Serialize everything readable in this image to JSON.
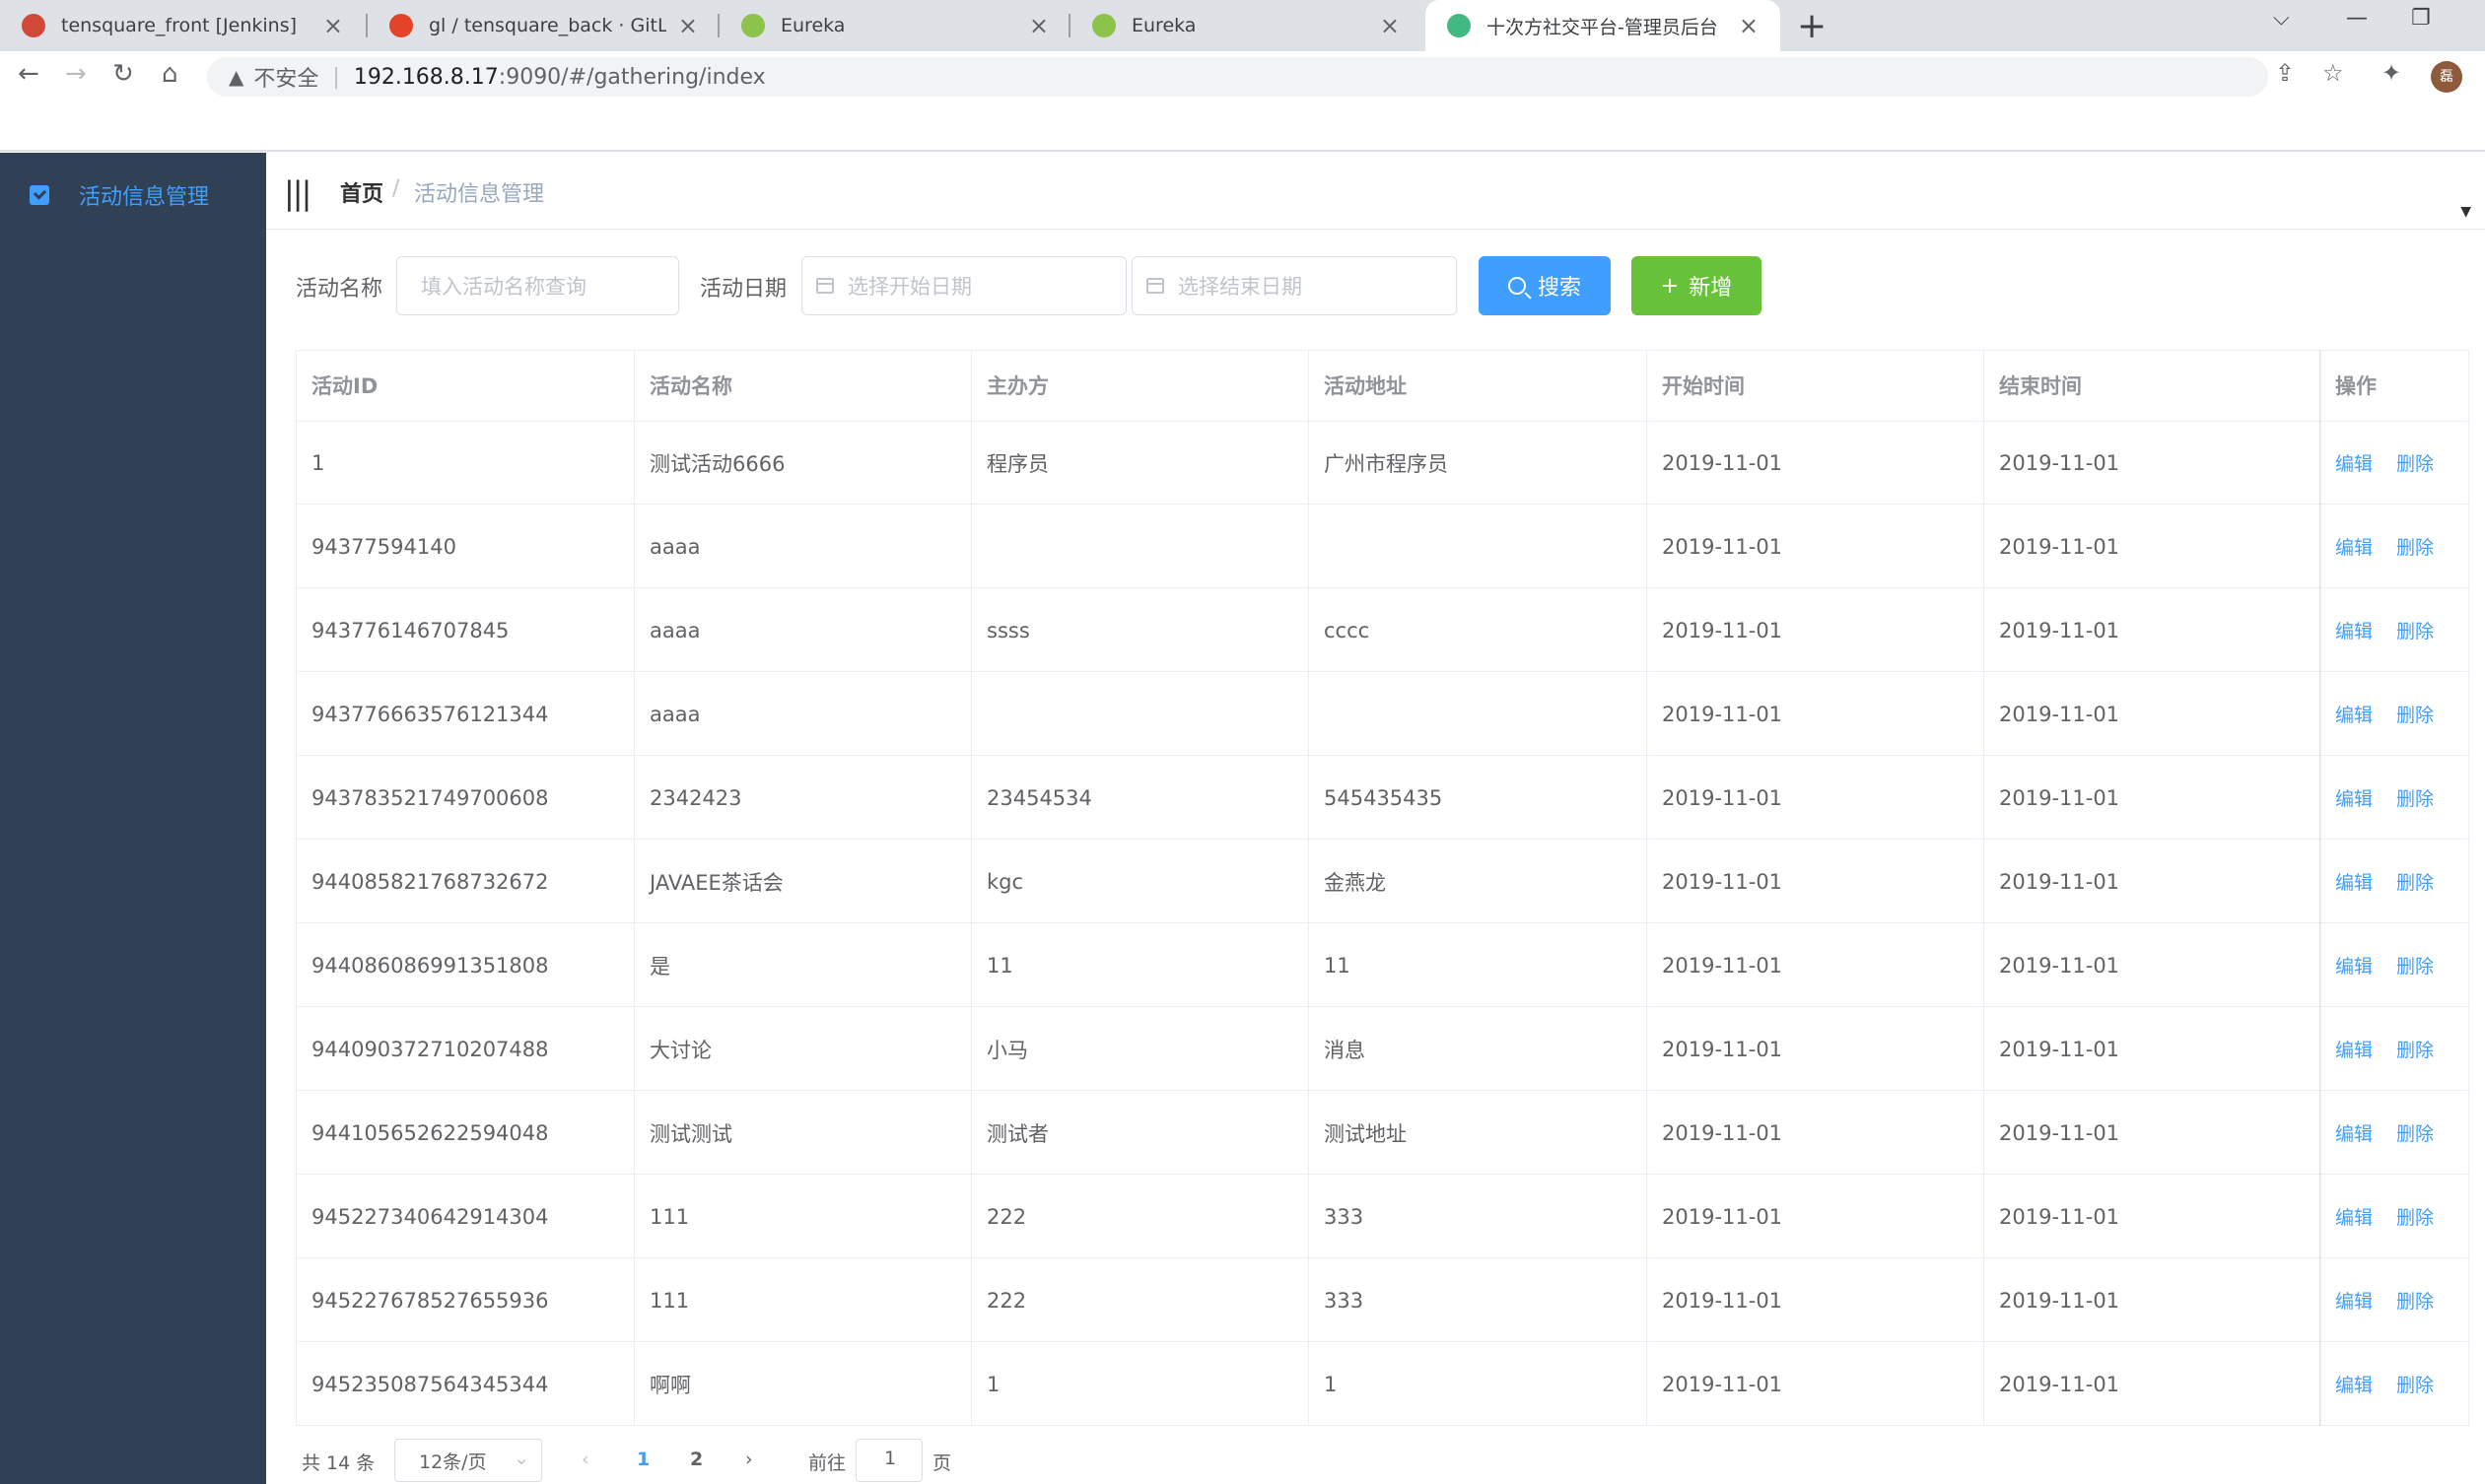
{
  "browser": {
    "tabs": [
      {
        "title": "tensquare_front [Jenkins]",
        "icon": "jenkins-icon",
        "color": "#d24939",
        "active": false
      },
      {
        "title": "gl / tensquare_back · GitLab",
        "icon": "gitlab-icon",
        "color": "#e24329",
        "active": false
      },
      {
        "title": "Eureka",
        "icon": "spring-leaf-icon",
        "color": "#8cc34a",
        "active": false
      },
      {
        "title": "Eureka",
        "icon": "spring-leaf-icon",
        "color": "#8cc34a",
        "active": false
      },
      {
        "title": "十次方社交平台-管理员后台",
        "icon": "vue-icon",
        "color": "#42b883",
        "active": true
      }
    ],
    "address": {
      "security": "不安全",
      "host": "192.168.8.17",
      "path": ":9090/#/gathering/index"
    },
    "avatar_text": "磊"
  },
  "sidebar": {
    "items": [
      {
        "label": "活动信息管理",
        "icon": "edit-square-icon"
      }
    ]
  },
  "breadcrumb": {
    "home": "首页",
    "current": "活动信息管理"
  },
  "search_form": {
    "name_label": "活动名称",
    "name_placeholder": "填入活动名称查询",
    "date_label": "活动日期",
    "start_placeholder": "选择开始日期",
    "end_placeholder": "选择结束日期",
    "search_button": "搜索",
    "add_button": "新增"
  },
  "table": {
    "columns": [
      "活动ID",
      "活动名称",
      "主办方",
      "活动地址",
      "开始时间",
      "结束时间",
      "操作"
    ],
    "action_edit": "编辑",
    "action_delete": "删除",
    "rows": [
      [
        "1",
        "测试活动6666",
        "程序员",
        "广州市程序员",
        "2019-11-01",
        "2019-11-01"
      ],
      [
        "94377594140",
        "aaaa",
        "",
        "",
        "2019-11-01",
        "2019-11-01"
      ],
      [
        "943776146707845",
        "aaaa",
        "ssss",
        "cccc",
        "2019-11-01",
        "2019-11-01"
      ],
      [
        "943776663576121344",
        "aaaa",
        "",
        "",
        "2019-11-01",
        "2019-11-01"
      ],
      [
        "943783521749700608",
        "2342423",
        "23454534",
        "545435435",
        "2019-11-01",
        "2019-11-01"
      ],
      [
        "944085821768732672",
        "JAVAEE茶话会",
        "kgc",
        "金燕龙",
        "2019-11-01",
        "2019-11-01"
      ],
      [
        "944086086991351808",
        "是",
        "11",
        "11",
        "2019-11-01",
        "2019-11-01"
      ],
      [
        "944090372710207488",
        "大讨论",
        "小马",
        "消息",
        "2019-11-01",
        "2019-11-01"
      ],
      [
        "944105652622594048",
        "测试测试",
        "测试者",
        "测试地址",
        "2019-11-01",
        "2019-11-01"
      ],
      [
        "945227340642914304",
        "111",
        "222",
        "333",
        "2019-11-01",
        "2019-11-01"
      ],
      [
        "945227678527655936",
        "111",
        "222",
        "333",
        "2019-11-01",
        "2019-11-01"
      ],
      [
        "945235087564345344",
        "啊啊",
        "1",
        "1",
        "2019-11-01",
        "2019-11-01"
      ]
    ]
  },
  "pagination": {
    "total": "共 14 条",
    "page_size": "12条/页",
    "pages": [
      "1",
      "2"
    ],
    "current_page": "1",
    "goto_prefix": "前往",
    "goto_value": "1",
    "goto_suffix": "页"
  },
  "colors": {
    "sidebar_bg": "#304156",
    "primary": "#409eff",
    "success": "#67c23a"
  }
}
